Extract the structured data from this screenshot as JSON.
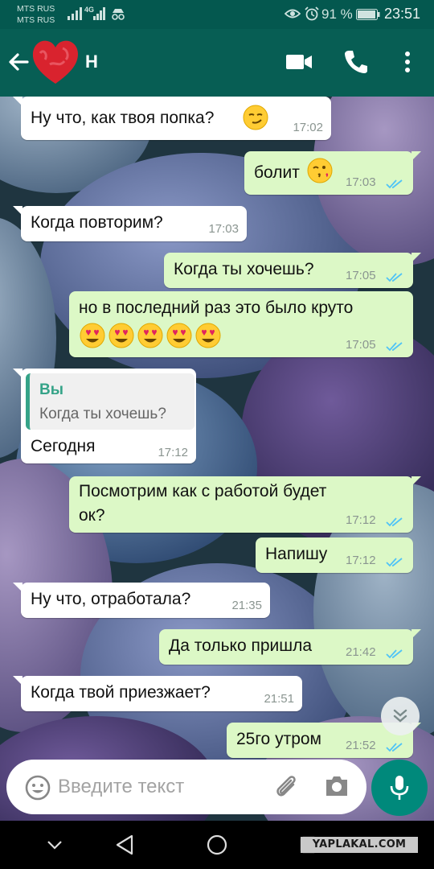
{
  "status_bar": {
    "carrier_1": "MTS RUS",
    "carrier_2": "MTS RUS",
    "network": "4G",
    "battery": "91 %",
    "time": "23:51"
  },
  "header": {
    "contact_name": "Н",
    "icons": [
      "back-arrow-icon",
      "avatar",
      "video-call-icon",
      "phone-icon",
      "more-vert-icon"
    ]
  },
  "messages": [
    {
      "dir": "in",
      "text": "Ну что, как твоя попка?",
      "emoji": "smirk",
      "time": "17:02"
    },
    {
      "dir": "out",
      "text": "болит",
      "emoji": "kiss-wink",
      "time": "17:03",
      "status": "read"
    },
    {
      "dir": "in",
      "text": "Когда повторим?",
      "time": "17:03"
    },
    {
      "dir": "out",
      "text": "Когда ты хочешь?",
      "time": "17:05",
      "status": "read"
    },
    {
      "dir": "out",
      "text": "но в последний раз это было круто",
      "emoji": "heart-eyes x5",
      "time": "17:05",
      "status": "read"
    },
    {
      "dir": "in",
      "reply_to": {
        "author": "Вы",
        "text": "Когда ты хочешь?"
      },
      "text": "Сегодня",
      "time": "17:12"
    },
    {
      "dir": "out",
      "text_line_1": "Посмотрим как с работой будет",
      "text_line_2": "ок?",
      "time": "17:12",
      "status": "read"
    },
    {
      "dir": "out",
      "text": "Напишу",
      "time": "17:12",
      "status": "read"
    },
    {
      "dir": "in",
      "text": "Ну что, отработала?",
      "time": "21:35"
    },
    {
      "dir": "out",
      "text": "Да только пришла",
      "time": "21:42",
      "status": "read"
    },
    {
      "dir": "in",
      "text": "Когда твой приезжает?",
      "time": "21:51"
    },
    {
      "dir": "out",
      "text": "25го утром",
      "time": "21:52",
      "status": "read"
    }
  ],
  "input": {
    "placeholder": "Введите текст"
  },
  "watermark": "YAPLAKAL.COM",
  "colors": {
    "header": "#075e54",
    "status_bar": "#04584f",
    "bubble_out": "#dcf8c6",
    "bubble_in": "#ffffff",
    "read_ticks": "#4fc3f7",
    "fab": "#00897b"
  }
}
